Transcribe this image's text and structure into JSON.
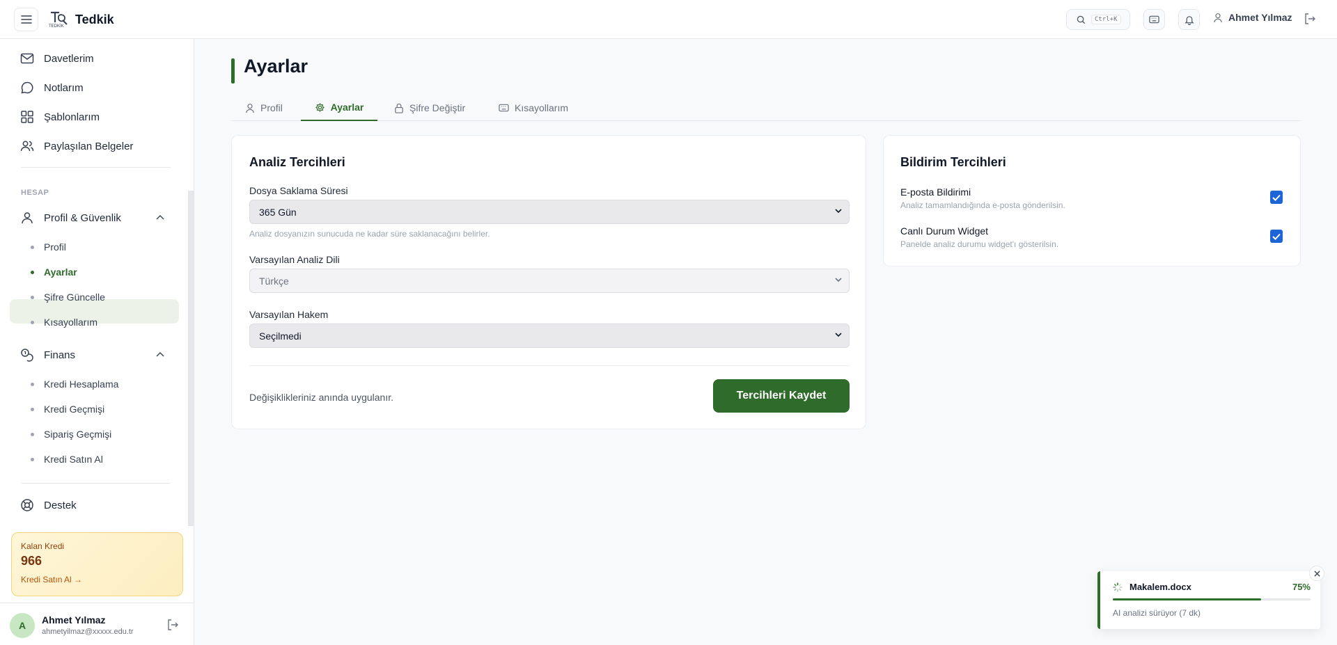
{
  "app": {
    "name": "Tedkik",
    "logo_caption": "TEDKİK"
  },
  "topbar": {
    "search_shortcut": "Ctrl+K",
    "user_name": "Ahmet Yılmaz"
  },
  "sidebar": {
    "top_items": [
      {
        "label": "Davetlerim",
        "icon": "mail-icon"
      },
      {
        "label": "Notlarım",
        "icon": "message-icon"
      },
      {
        "label": "Şablonlarım",
        "icon": "grid-icon"
      },
      {
        "label": "Paylaşılan Belgeler",
        "icon": "users-icon"
      }
    ],
    "section_label": "HESAP",
    "groups": [
      {
        "label": "Profil & Güvenlik",
        "icon": "user-icon",
        "items": [
          "Profil",
          "Ayarlar",
          "Şifre Güncelle",
          "Kısayollarım"
        ],
        "active": "Ayarlar"
      },
      {
        "label": "Finans",
        "icon": "coins-icon",
        "items": [
          "Kredi Hesaplama",
          "Kredi Geçmişi",
          "Sipariş Geçmişi",
          "Kredi Satın Al"
        ]
      }
    ],
    "support_label": "Destek",
    "credit": {
      "label": "Kalan Kredi",
      "value": "966",
      "link": "Kredi Satın Al →"
    },
    "user": {
      "initial": "A",
      "name": "Ahmet Yılmaz",
      "email": "ahmetyilmaz@xxxxx.edu.tr"
    }
  },
  "page": {
    "title": "Ayarlar",
    "tabs": [
      {
        "label": "Profil",
        "icon": "user-icon"
      },
      {
        "label": "Ayarlar",
        "icon": "gear-icon",
        "active": true
      },
      {
        "label": "Şifre Değiştir",
        "icon": "lock-icon"
      },
      {
        "label": "Kısayollarım",
        "icon": "keyboard-icon"
      }
    ]
  },
  "analysis": {
    "title": "Analiz Tercihleri",
    "retention_label": "Dosya Saklama Süresi",
    "retention_value": "365 Gün",
    "retention_help": "Analiz dosyanızın sunucuda ne kadar süre saklanacağını belirler.",
    "language_label": "Varsayılan Analiz Dili",
    "language_value": "Türkçe",
    "referee_label": "Varsayılan Hakem",
    "referee_value": "Seçilmedi",
    "footer_note": "Değişiklikleriniz anında uygulanır.",
    "save_label": "Tercihleri Kaydet"
  },
  "notifications": {
    "title": "Bildirim Tercihleri",
    "items": [
      {
        "title": "E-posta Bildirimi",
        "desc": "Analiz tamamlandığında e-posta gönderilsin.",
        "checked": true
      },
      {
        "title": "Canlı Durum Widget",
        "desc": "Panelde analiz durumu widget'ı gösterilsin.",
        "checked": true
      }
    ]
  },
  "toast": {
    "file": "Makalem.docx",
    "percent_label": "75%",
    "progress": 0.75,
    "status": "AI analizi sürüyor (7 dk)"
  },
  "colors": {
    "brand": "#2f6b2a",
    "checkbox": "#1d64d8",
    "credit_bg": "#fef6d8"
  }
}
